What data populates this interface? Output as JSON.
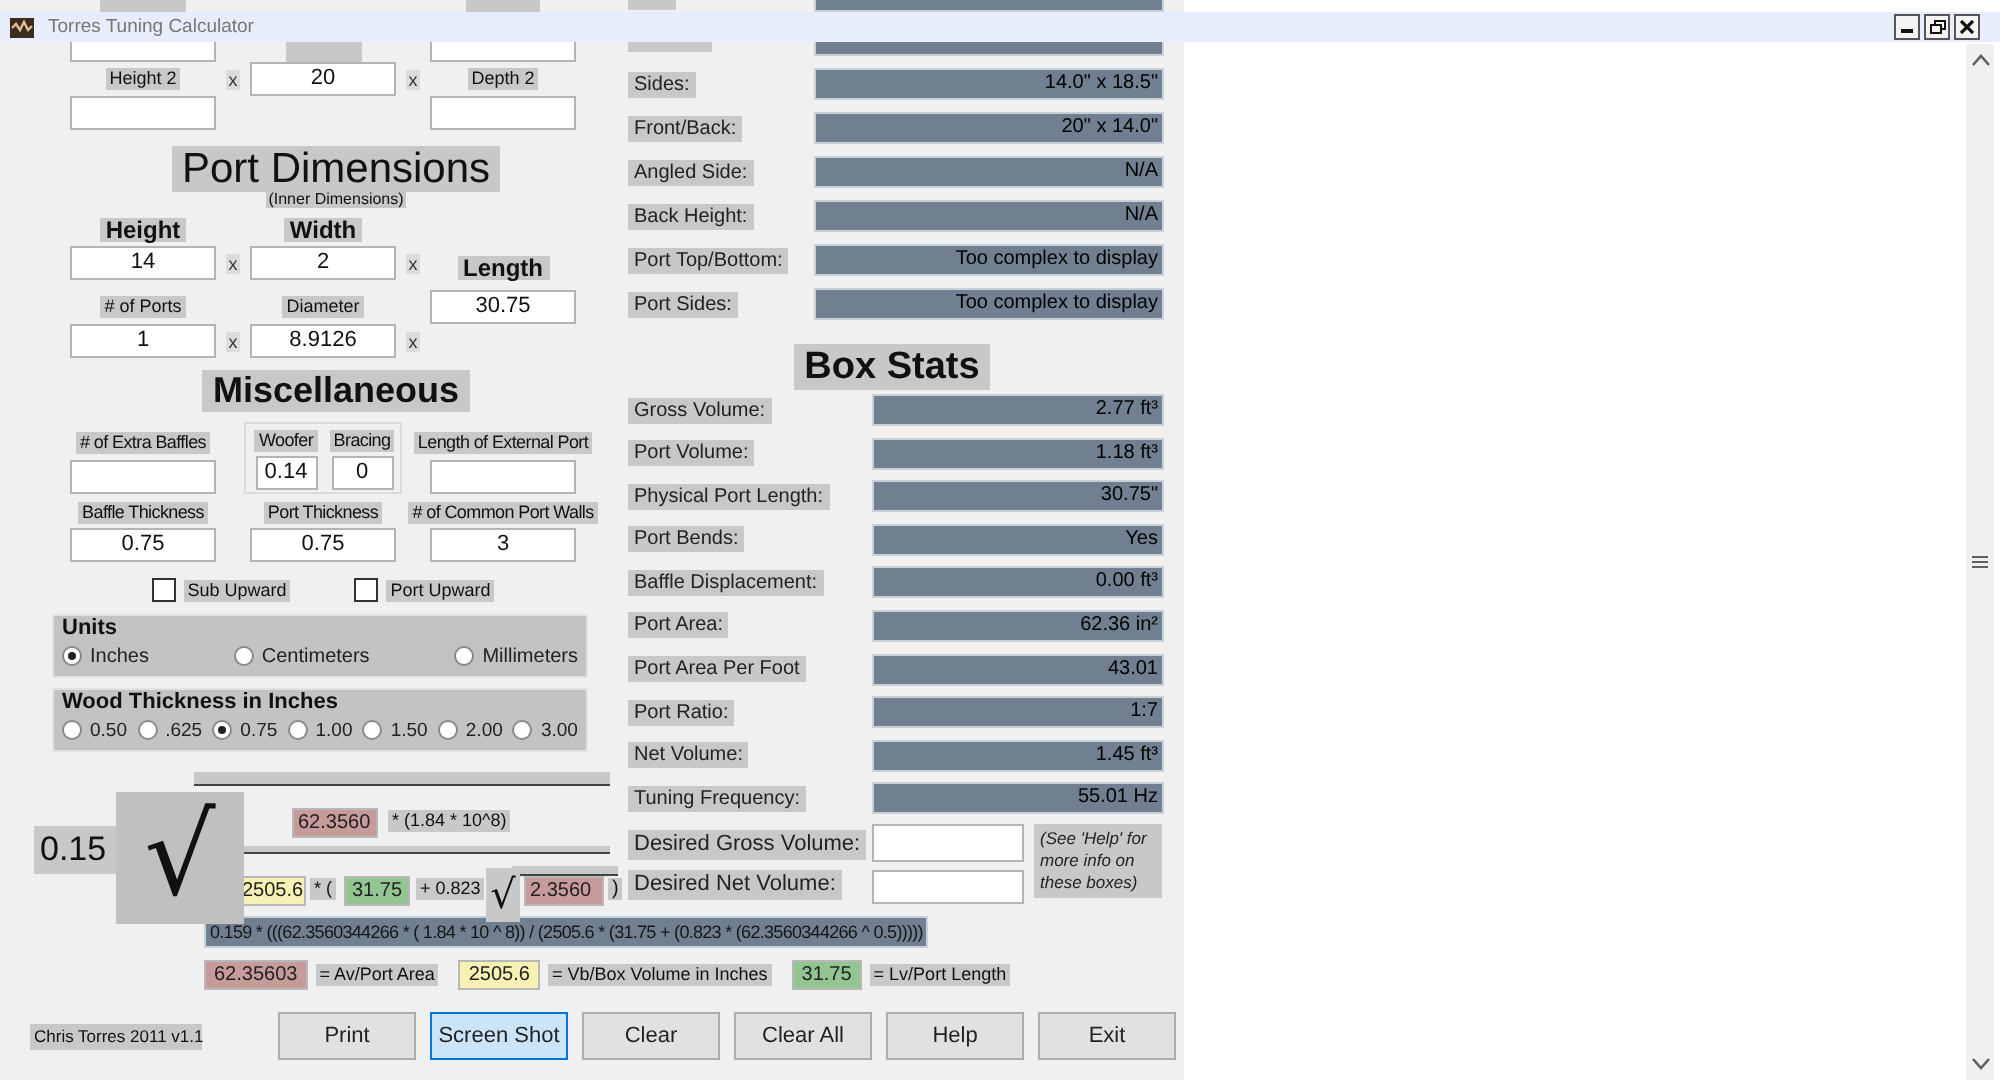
{
  "window": {
    "title": "Torres Tuning Calculator"
  },
  "box_dimensions": {
    "height2_label": "Height 2",
    "width_value": "20",
    "depth2_label": "Depth 2",
    "operators": [
      "x",
      "x"
    ]
  },
  "port_dimensions": {
    "title": "Port Dimensions",
    "subtitle": "(Inner Dimensions)",
    "height_label": "Height",
    "width_label": "Width",
    "height_value": "14",
    "width_value": "2",
    "length_label": "Length",
    "ports_label": "# of Ports",
    "diameter_label": "Diameter",
    "length_value": "30.75",
    "ports_value": "1",
    "diameter_value": "8.9126",
    "operators": [
      "x",
      "x",
      "x",
      "x"
    ]
  },
  "miscellaneous": {
    "title": "Miscellaneous",
    "extra_baffles_label": "# of Extra Baffles",
    "woofer_label": "Woofer",
    "bracing_label": "Bracing",
    "external_port_label": "Length of External Port",
    "woofer_value": "0.14",
    "bracing_value": "0",
    "baffle_thickness_label": "Baffle Thickness",
    "port_thickness_label": "Port Thickness",
    "common_walls_label": "# of Common Port Walls",
    "baffle_thickness_value": "0.75",
    "port_thickness_value": "0.75",
    "common_walls_value": "3",
    "checkboxes": [
      {
        "label": "Sub Upward",
        "checked": false
      },
      {
        "label": "Port Upward",
        "checked": false
      }
    ]
  },
  "units": {
    "title": "Units",
    "options": [
      {
        "label": "Inches",
        "selected": true
      },
      {
        "label": "Centimeters",
        "selected": false
      },
      {
        "label": "Millimeters",
        "selected": false
      }
    ]
  },
  "wood_thickness": {
    "title": "Wood Thickness in Inches",
    "options": [
      {
        "label": "0.50",
        "selected": false
      },
      {
        "label": ".625",
        "selected": false
      },
      {
        "label": "0.75",
        "selected": true
      },
      {
        "label": "1.00",
        "selected": false
      },
      {
        "label": "1.50",
        "selected": false
      },
      {
        "label": "2.00",
        "selected": false
      },
      {
        "label": "3.00",
        "selected": false
      }
    ]
  },
  "formula": {
    "coefficient": "0.15",
    "radical": "√",
    "numerator": {
      "value": "62.3560",
      "color": "#c89b9b"
    },
    "numerator_factor": "* (1.84 * 10^8)",
    "volume": {
      "value": "2505.6",
      "color": "#f7f1b5"
    },
    "open_paren": "* (",
    "length": {
      "value": "31.75",
      "color": "#92c592"
    },
    "plus": "+ 0.823",
    "inner_radical": "√",
    "area": {
      "value": "2.3560",
      "color": "#c89b9b"
    },
    "close_paren": ")",
    "expression": "0.159 * (((62.3560344266 * ( 1.84 * 10 ^ 8)) / (2505.6 * (31.75 + (0.823 * (62.3560344266 ^ 0.5)))))",
    "legend": [
      {
        "value": "62.35603",
        "color": "#c89b9b",
        "meaning": "= Av/Port Area"
      },
      {
        "value": "2505.6",
        "color": "#f7f1b5",
        "meaning": "= Vb/Box Volume in Inches"
      },
      {
        "value": "31.75",
        "color": "#92c592",
        "meaning": "= Lv/Port Length"
      }
    ]
  },
  "panel_sizes": [
    {
      "label": "Sides:",
      "value": "14.0\" x 18.5\""
    },
    {
      "label": "Front/Back:",
      "value": "20\" x 14.0\""
    },
    {
      "label": "Angled Side:",
      "value": "N/A"
    },
    {
      "label": "Back Height:",
      "value": "N/A"
    },
    {
      "label": "Port Top/Bottom:",
      "value": "Too complex to display"
    },
    {
      "label": "Port Sides:",
      "value": "Too complex to display"
    }
  ],
  "box_stats": {
    "title": "Box Stats",
    "rows": [
      {
        "label": "Gross Volume:",
        "value": "2.77 ft³"
      },
      {
        "label": "Port Volume:",
        "value": "1.18 ft³"
      },
      {
        "label": "Physical Port Length:",
        "value": "30.75\""
      },
      {
        "label": "Port Bends:",
        "value": "Yes"
      },
      {
        "label": "Baffle Displacement:",
        "value": "0.00 ft³"
      },
      {
        "label": "Port Area:",
        "value": "62.36 in²"
      },
      {
        "label": "Port Area Per Foot",
        "value": "43.01"
      },
      {
        "label": "Port Ratio:",
        "value": "1:7"
      },
      {
        "label": "Net Volume:",
        "value": "1.45 ft³"
      },
      {
        "label": "Tuning Frequency:",
        "value": "55.01 Hz"
      }
    ],
    "desired": [
      {
        "label": "Desired Gross Volume:"
      },
      {
        "label": "Desired Net Volume:"
      }
    ],
    "note": "(See 'Help' for more info on these boxes)"
  },
  "footer": "Chris Torres 2011 v1.1",
  "buttons": [
    {
      "label": "Print",
      "focused": false
    },
    {
      "label": "Screen Shot",
      "focused": true
    },
    {
      "label": "Clear",
      "focused": false
    },
    {
      "label": "Clear All",
      "focused": false
    },
    {
      "label": "Help",
      "focused": false
    },
    {
      "label": "Exit",
      "focused": false
    }
  ]
}
